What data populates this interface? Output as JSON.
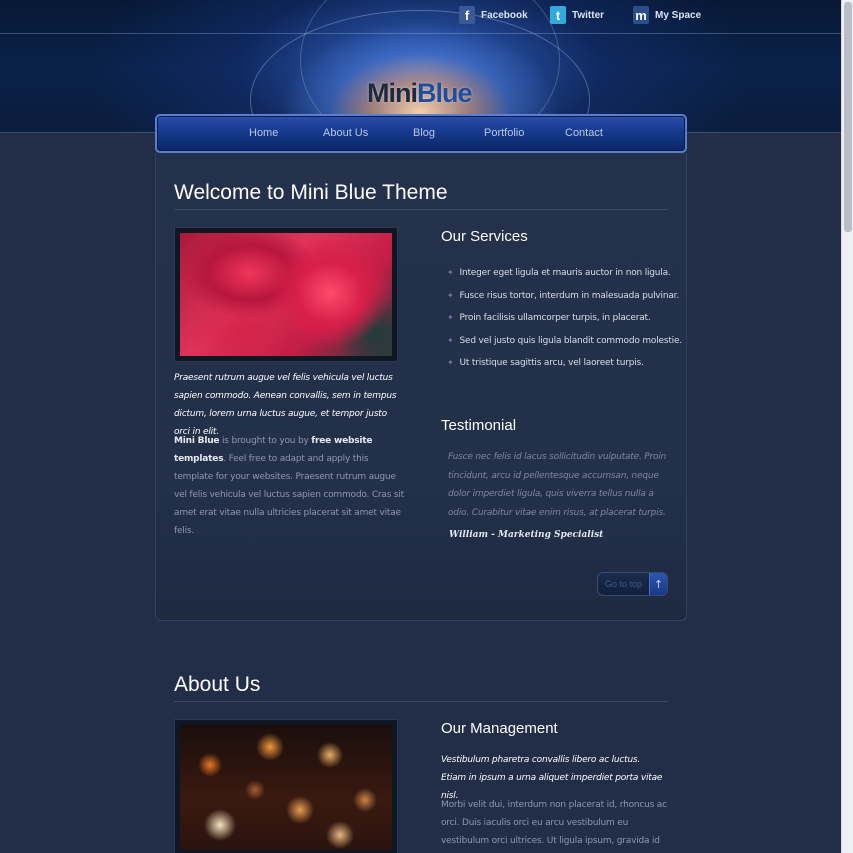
{
  "header": {
    "social": [
      {
        "label": "Facebook",
        "icon": "facebook-icon",
        "glyph": "f",
        "color": "#3b5998"
      },
      {
        "label": "Twitter",
        "icon": "twitter-icon",
        "glyph": "t",
        "color": "#33aadd"
      },
      {
        "label": "My Space",
        "icon": "myspace-icon",
        "glyph": "m",
        "color": "#2a4d8c"
      }
    ],
    "logo": {
      "part1": "Mini",
      "part2": "Blue"
    }
  },
  "nav": {
    "items": [
      "Home",
      "About Us",
      "Blog",
      "Portfolio",
      "Contact"
    ]
  },
  "welcome": {
    "title": "Welcome to Mini Blue Theme",
    "lead": "Praesent rutrum augue vel felis vehicula vel luctus sapien commodo. Aenean convallis, sem in tempus dictum, lorem urna luctus augue, et tempor justo orci in elit.",
    "body_strong1": "Mini Blue",
    "body_text1": " is brought to you by ",
    "body_strong2": "free website templates",
    "body_text2": ". Feel free to adapt and apply this template for your websites. Praesent rutrum augue vel felis vehicula vel luctus sapien commodo. Cras sit amet erat vitae nulla ultricies placerat sit amet vitae felis."
  },
  "services": {
    "title": "Our Services",
    "items": [
      "Integer eget ligula et mauris auctor in non ligula.",
      "Fusce risus tortor, interdum in malesuada pulvinar.",
      "Proin facilisis ullamcorper turpis, in placerat.",
      "Sed vel justo quis ligula blandit commodo molestie.",
      "Ut tristique sagittis arcu, vel laoreet turpis."
    ]
  },
  "testimonial": {
    "title": "Testimonial",
    "quote": "Fusce nec felis id lacus sollicitudin vulputate. Proin tincidunt, arcu id pellentesque accumsan, neque dolor imperdiet ligula, quis viverra tellus nulla a odio. Curabitur vitae enim risus, at placerat turpis.",
    "author": "William - Marketing Specialist"
  },
  "go_top": {
    "label": "Go to top",
    "arrow": "↑"
  },
  "about": {
    "title": "About Us",
    "management_title": "Our Management",
    "lead": "Vestibulum pharetra convallis libero ac luctus. Etiam in ipsum a urna aliquet imperdiet porta vitae nisl.",
    "body": "Morbi velit dui, interdum non placerat id, rhoncus ac orci. Duis iaculis orci eu arcu vestibulum eu vestibulum orci ultrices. Ut ligula ipsum, gravida id euismod quis, faucibus"
  }
}
